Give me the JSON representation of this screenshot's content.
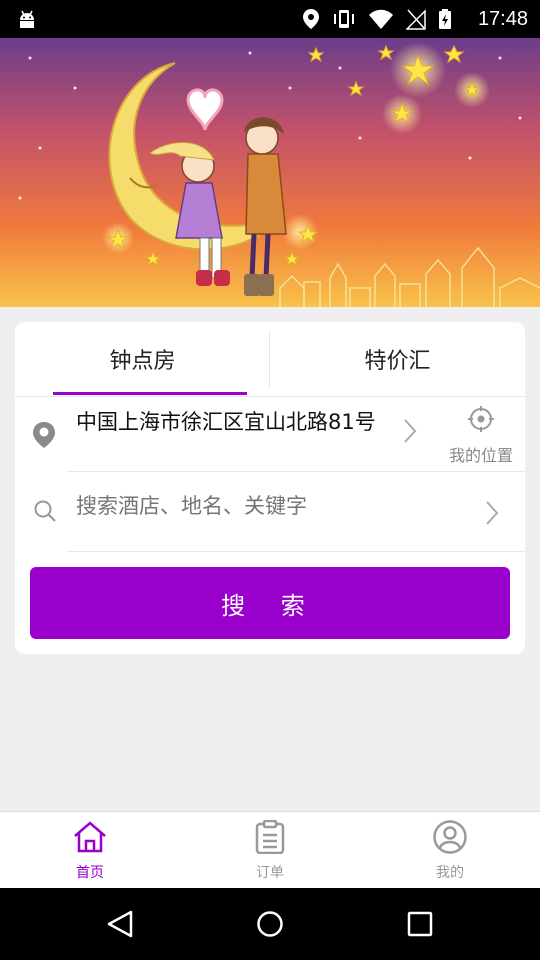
{
  "status_bar": {
    "time": "17:48"
  },
  "tabs": [
    {
      "label": "钟点房",
      "selected": true
    },
    {
      "label": "特价汇",
      "selected": false
    }
  ],
  "location": {
    "address": "中国上海市徐汇区宜山北路81号",
    "my_location_label": "我的位置"
  },
  "search": {
    "placeholder": "搜索酒店、地名、关键字",
    "button_label": "搜 索"
  },
  "bottom_nav": [
    {
      "label": "首页",
      "icon": "home-icon",
      "active": true
    },
    {
      "label": "订单",
      "icon": "clipboard-icon",
      "active": false
    },
    {
      "label": "我的",
      "icon": "profile-icon",
      "active": false
    }
  ],
  "colors": {
    "accent": "#9900cc",
    "background": "#efefef"
  }
}
